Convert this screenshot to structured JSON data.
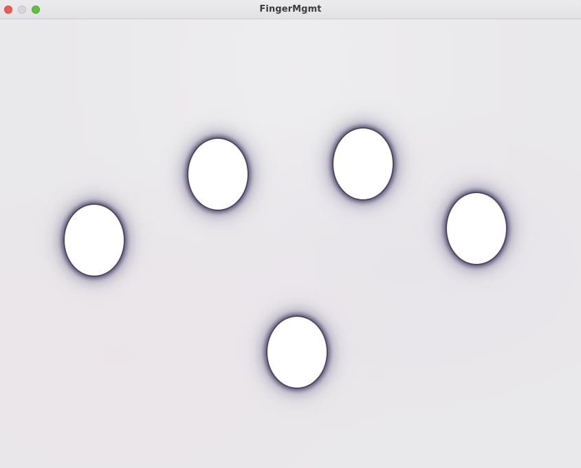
{
  "window": {
    "title": "FingerMgmt",
    "controls": {
      "close": "close-button",
      "minimize": "minimize-button",
      "zoom": "zoom-button"
    },
    "colors": {
      "close": "#ee5b52",
      "minimize": "#d6d5d7",
      "zoom": "#5fc13d"
    }
  },
  "canvas": {
    "background_color": "#e9e8ea",
    "touch_fill_color": "#ffffff",
    "touch_glow_color": "#4c4666",
    "touch_point_count": 5
  }
}
